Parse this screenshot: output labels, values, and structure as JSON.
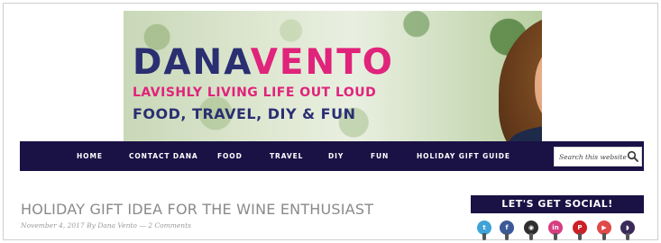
{
  "banner": {
    "brand_first": "DANA",
    "brand_last": "VENTO",
    "tagline": "LAVISHLY LIVING LIFE OUT LOUD",
    "subtagline": "FOOD, TRAVEL, DIY & FUN"
  },
  "nav": {
    "items": [
      {
        "label": "HOME"
      },
      {
        "label": "CONTACT DANA"
      },
      {
        "label": "FOOD"
      },
      {
        "label": "TRAVEL"
      },
      {
        "label": "DIY"
      },
      {
        "label": "FUN"
      },
      {
        "label": "HOLIDAY GIFT GUIDE"
      }
    ],
    "search_placeholder": "Search this website ..."
  },
  "post": {
    "title": "HOLIDAY GIFT IDEA FOR THE WINE ENTHUSIAST",
    "date": "November 4, 2017",
    "by": "By",
    "author": "Dana Vento",
    "separator": "—",
    "comments": "2 Comments"
  },
  "sidebar": {
    "social_heading": "LET'S GET SOCIAL!",
    "social_icons": [
      {
        "name": "twitter-icon",
        "glyph": "t",
        "color": "#3fa3d8"
      },
      {
        "name": "facebook-icon",
        "glyph": "f",
        "color": "#3b5998"
      },
      {
        "name": "instagram-icon",
        "glyph": "◉",
        "color": "#2e2e2e"
      },
      {
        "name": "linkedin-icon",
        "glyph": "in",
        "color": "#d63e7f"
      },
      {
        "name": "pinterest-icon",
        "glyph": "P",
        "color": "#cb2027"
      },
      {
        "name": "youtube-icon",
        "glyph": "▶",
        "color": "#e04a4a"
      },
      {
        "name": "rss-icon",
        "glyph": "◗",
        "color": "#3a2a5a"
      }
    ]
  },
  "colors": {
    "nav_bg": "#1a1145",
    "brand_navy": "#2a2f72",
    "brand_pink": "#e0237b"
  }
}
